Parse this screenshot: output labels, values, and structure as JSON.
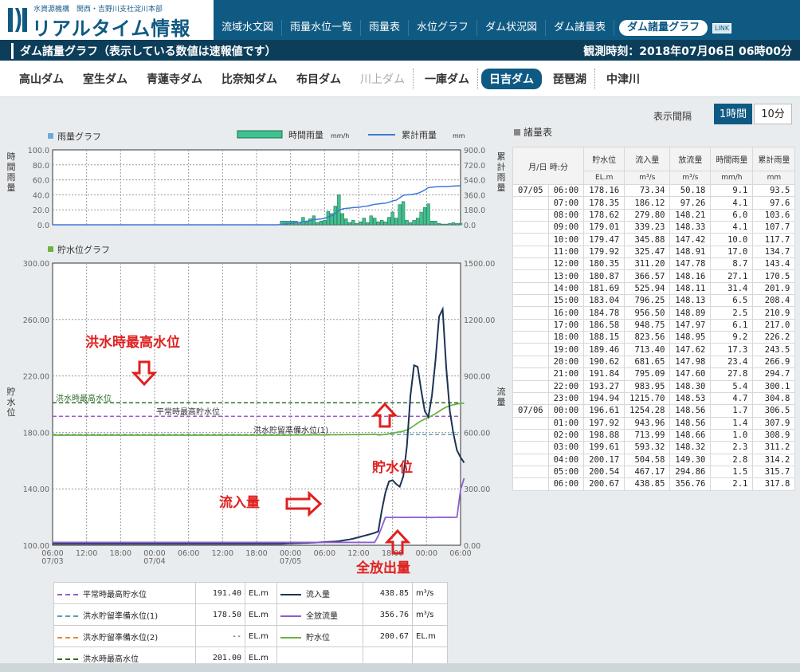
{
  "header": {
    "org": "水資源機構　関西・吉野川支社淀川本部",
    "title": "リアルタイム情報",
    "nav": [
      "流域水文図",
      "雨量水位一覧",
      "雨量表",
      "水位グラフ",
      "ダム状況図",
      "ダム諸量表",
      "ダム諸量グラフ"
    ],
    "badge": "LINK"
  },
  "titlebar": {
    "title": "ダム諸量グラフ（表示している数値は速報値です）",
    "observed": "観測時刻：2018年07月06日 06時00分"
  },
  "dams": [
    "高山ダム",
    "室生ダム",
    "青蓮寺ダム",
    "比奈知ダム",
    "布目ダム",
    "川上ダム",
    "一庫ダム",
    "日吉ダム",
    "琵琶湖",
    "中津川"
  ],
  "interval": {
    "label": "表示間隔",
    "options": [
      "1時間",
      "10分"
    ]
  },
  "table": {
    "title": "諸量表",
    "headers": [
      "月/日 時:分",
      "貯水位",
      "流入量",
      "放流量",
      "時間雨量",
      "累計雨量"
    ],
    "units": [
      "EL.m",
      "m³/s",
      "m³/s",
      "mm/h",
      "mm"
    ],
    "rows": [
      [
        "07/05",
        "06:00",
        "178.16",
        "73.34",
        "50.18",
        "9.1",
        "93.5"
      ],
      [
        "",
        "07:00",
        "178.35",
        "186.12",
        "97.26",
        "4.1",
        "97.6"
      ],
      [
        "",
        "08:00",
        "178.62",
        "279.80",
        "148.21",
        "6.0",
        "103.6"
      ],
      [
        "",
        "09:00",
        "179.01",
        "339.23",
        "148.33",
        "4.1",
        "107.7"
      ],
      [
        "",
        "10:00",
        "179.47",
        "345.88",
        "147.42",
        "10.0",
        "117.7"
      ],
      [
        "",
        "11:00",
        "179.92",
        "325.47",
        "148.91",
        "17.0",
        "134.7"
      ],
      [
        "",
        "12:00",
        "180.35",
        "311.20",
        "147.78",
        "8.7",
        "143.4"
      ],
      [
        "",
        "13:00",
        "180.87",
        "366.57",
        "148.16",
        "27.1",
        "170.5"
      ],
      [
        "",
        "14:00",
        "181.69",
        "525.94",
        "148.11",
        "31.4",
        "201.9"
      ],
      [
        "",
        "15:00",
        "183.04",
        "796.25",
        "148.13",
        "6.5",
        "208.4"
      ],
      [
        "",
        "16:00",
        "184.78",
        "956.50",
        "148.89",
        "2.5",
        "210.9"
      ],
      [
        "",
        "17:00",
        "186.58",
        "948.75",
        "147.97",
        "6.1",
        "217.0"
      ],
      [
        "",
        "18:00",
        "188.15",
        "823.56",
        "148.95",
        "9.2",
        "226.2"
      ],
      [
        "",
        "19:00",
        "189.46",
        "713.40",
        "147.62",
        "17.3",
        "243.5"
      ],
      [
        "",
        "20:00",
        "190.62",
        "681.65",
        "147.98",
        "23.4",
        "266.9"
      ],
      [
        "",
        "21:00",
        "191.84",
        "795.09",
        "147.60",
        "27.8",
        "294.7"
      ],
      [
        "",
        "22:00",
        "193.27",
        "983.95",
        "148.30",
        "5.4",
        "300.1"
      ],
      [
        "",
        "23:00",
        "194.94",
        "1215.70",
        "148.53",
        "4.7",
        "304.8"
      ],
      [
        "07/06",
        "00:00",
        "196.61",
        "1254.28",
        "148.56",
        "1.7",
        "306.5"
      ],
      [
        "",
        "01:00",
        "197.92",
        "943.96",
        "148.56",
        "1.4",
        "307.9"
      ],
      [
        "",
        "02:00",
        "198.88",
        "713.99",
        "148.66",
        "1.0",
        "308.9"
      ],
      [
        "",
        "03:00",
        "199.61",
        "593.32",
        "148.32",
        "2.3",
        "311.2"
      ],
      [
        "",
        "04:00",
        "200.17",
        "504.58",
        "149.30",
        "2.8",
        "314.2"
      ],
      [
        "",
        "05:00",
        "200.54",
        "467.17",
        "294.86",
        "1.5",
        "315.7"
      ],
      [
        "",
        "06:00",
        "200.67",
        "438.85",
        "356.76",
        "2.1",
        "317.8"
      ]
    ]
  },
  "legend": {
    "rows": [
      {
        "name": "平常時最高貯水位",
        "value": "191.40",
        "unit": "EL.m",
        "color": "#9a5fc9",
        "dash": true
      },
      {
        "name": "洪水貯留準備水位(1)",
        "value": "178.50",
        "unit": "EL.m",
        "color": "#5b9bb8",
        "dash": true
      },
      {
        "name": "洪水貯留準備水位(2)",
        "value": "--",
        "unit": "EL.m",
        "color": "#e48a3a",
        "dash": true
      },
      {
        "name": "洪水時最高水位",
        "value": "201.00",
        "unit": "EL.m",
        "color": "#2f6e2f",
        "dash": true
      }
    ],
    "series": [
      {
        "name": "流入量",
        "value": "438.85",
        "unit": "m³/s",
        "color": "#1b3355"
      },
      {
        "name": "全放流量",
        "value": "356.76",
        "unit": "m³/s",
        "color": "#8a5fd0"
      },
      {
        "name": "貯水位",
        "value": "200.67",
        "unit": "EL.m",
        "color": "#6cb33f"
      }
    ]
  },
  "chart_data": [
    {
      "type": "bar",
      "title": "雨量グラフ",
      "ylabel": "時間雨量",
      "y2label": "累計雨量",
      "ylim": [
        0,
        100
      ],
      "y2lim": [
        0,
        900
      ],
      "legend": [
        {
          "name": "時間雨量",
          "unit": "mm/h"
        },
        {
          "name": "累計雨量",
          "unit": "mm"
        }
      ],
      "yticks": [
        "100.0",
        "80.0",
        "60.0",
        "40.0",
        "20.0",
        "0.0"
      ],
      "y2ticks": [
        "900.0",
        "720.0",
        "540.0",
        "360.0",
        "180.0",
        "0.0"
      ],
      "x_start": "07/03 06:00",
      "x_step_hours": 1,
      "series": [
        {
          "name": "時間雨量",
          "values": [
            0,
            0,
            0,
            0,
            0,
            0,
            0,
            0,
            0,
            0,
            0,
            0,
            0,
            0,
            0,
            0,
            0,
            0,
            0,
            0,
            0,
            0,
            0,
            0,
            0,
            0,
            0,
            0,
            0,
            0,
            0,
            0,
            0,
            0,
            0,
            0,
            0,
            0,
            0,
            0,
            0,
            0,
            0,
            0,
            0,
            0,
            0,
            0,
            0,
            0,
            0,
            0,
            0,
            0,
            0,
            0,
            0,
            0,
            0,
            0,
            0,
            0,
            0,
            0,
            5,
            5,
            5,
            5,
            5,
            3,
            10,
            5,
            8,
            12,
            3,
            5,
            6,
            18,
            15,
            25,
            40,
            15,
            8,
            3,
            6,
            2,
            4,
            9,
            3,
            12,
            9,
            4,
            6,
            4,
            10,
            17,
            9,
            27,
            31,
            6,
            3,
            6,
            9,
            17,
            23,
            28,
            5,
            5,
            2,
            1,
            1,
            2,
            3,
            2,
            2
          ]
        },
        {
          "name": "累計雨量",
          "values": [
            0,
            0,
            0,
            0,
            0,
            0,
            0,
            0,
            0,
            0,
            0,
            0,
            0,
            0,
            0,
            0,
            0,
            0,
            0,
            0,
            0,
            0,
            0,
            0,
            0,
            0,
            0,
            0,
            0,
            0,
            0,
            0,
            0,
            0,
            0,
            0,
            0,
            0,
            0,
            0,
            0,
            0,
            0,
            0,
            0,
            0,
            0,
            0,
            0,
            0,
            0,
            0,
            0,
            0,
            0,
            0,
            0,
            0,
            0,
            0,
            0,
            0,
            0,
            0,
            5,
            10,
            15,
            20,
            25,
            28,
            38,
            43,
            51,
            63,
            66,
            71,
            77,
            95,
            110,
            135,
            175,
            190,
            198,
            201,
            207,
            209,
            213,
            222,
            225,
            237,
            246,
            250,
            256,
            260,
            270,
            287,
            296,
            323,
            354,
            360,
            363,
            369,
            378,
            395,
            418,
            446,
            451,
            456,
            458,
            459,
            460,
            462,
            465,
            467,
            469
          ]
        }
      ]
    },
    {
      "type": "line",
      "title": "貯水位グラフ",
      "ylabel": "貯水位",
      "y2label": "流量",
      "ylim": [
        100,
        300
      ],
      "y2lim": [
        0,
        1500
      ],
      "yticks": [
        "300.00",
        "260.00",
        "220.00",
        "180.00",
        "140.00",
        "100.00"
      ],
      "y2ticks": [
        "1500.00",
        "1200.00",
        "900.00",
        "600.00",
        "300.00",
        "0.00"
      ],
      "xticks": [
        "06:00",
        "12:00",
        "18:00",
        "00:00",
        "06:00",
        "12:00",
        "18:00",
        "00:00",
        "06:00",
        "12:00",
        "18:00",
        "00:00",
        "06:00"
      ],
      "xdates": [
        "07/03",
        "",
        "",
        "07/04",
        "",
        "",
        "",
        "07/05",
        "",
        "",
        "",
        "",
        ""
      ],
      "x_start": "07/03 06:00",
      "x_step_hours": 1,
      "lines": [
        {
          "name": "洪水時最高水位",
          "value": 201.0
        },
        {
          "name": "平常時最高貯水位",
          "value": 191.4
        },
        {
          "name": "洪水貯留準備水位(1)",
          "value": 178.5
        }
      ],
      "series": [
        {
          "name": "貯水位",
          "values": [
            178.0,
            178.0,
            178.0,
            178.0,
            178.0,
            178.0,
            178.0,
            178.0,
            178.0,
            178.0,
            178.0,
            178.0,
            178.0,
            178.0,
            178.0,
            178.0,
            178.0,
            178.0,
            178.0,
            178.0,
            178.0,
            178.0,
            178.0,
            178.0,
            178.0,
            178.0,
            178.0,
            178.0,
            178.0,
            178.0,
            178.0,
            178.0,
            178.0,
            178.0,
            178.0,
            178.0,
            178.0,
            178.0,
            178.0,
            178.0,
            178.0,
            178.0,
            178.0,
            178.0,
            178.0,
            178.0,
            178.0,
            178.0,
            178.0,
            178.0,
            178.0,
            178.0,
            178.0,
            178.0,
            178.0,
            178.0,
            178.0,
            178.0,
            178.0,
            178.0,
            178.0,
            178.0,
            178.0,
            178.0,
            178.0,
            178.0,
            178.0,
            178.1,
            178.1,
            178.1,
            178.1,
            178.1,
            178.1,
            178.2,
            178.2,
            178.2,
            178.2,
            178.2,
            178.3,
            178.3,
            178.3,
            178.3,
            178.4,
            178.4,
            178.4,
            178.4,
            178.5,
            178.5,
            178.6,
            178.6,
            178.8,
            178.16,
            178.35,
            178.62,
            179.01,
            179.47,
            179.92,
            180.35,
            180.87,
            181.69,
            183.04,
            184.78,
            186.58,
            188.15,
            189.46,
            190.62,
            191.84,
            193.27,
            194.94,
            196.61,
            197.92,
            198.88,
            199.61,
            200.17,
            200.54,
            200.67
          ]
        },
        {
          "name": "流入量",
          "values": [
            8,
            8,
            8,
            8,
            8,
            8,
            8,
            8,
            8,
            8,
            8,
            8,
            8,
            8,
            8,
            8,
            8,
            8,
            8,
            8,
            8,
            8,
            8,
            8,
            8,
            8,
            8,
            8,
            8,
            8,
            8,
            8,
            8,
            8,
            8,
            8,
            8,
            8,
            8,
            8,
            8,
            8,
            8,
            8,
            8,
            8,
            8,
            8,
            8,
            8,
            8,
            8,
            8,
            8,
            8,
            8,
            8,
            8,
            8,
            8,
            8,
            8,
            8,
            8,
            8,
            9,
            10,
            10,
            11,
            11,
            12,
            12,
            13,
            14,
            15,
            16,
            17,
            18,
            19,
            20,
            22,
            25,
            28,
            31,
            35,
            40,
            45,
            50,
            55,
            60,
            66,
            73.34,
            186.12,
            279.8,
            339.23,
            345.88,
            325.47,
            311.2,
            366.57,
            525.94,
            796.25,
            956.5,
            948.75,
            823.56,
            713.4,
            681.65,
            795.09,
            983.95,
            1215.7,
            1254.28,
            943.96,
            713.99,
            593.32,
            504.58,
            467.17,
            438.85
          ]
        },
        {
          "name": "全放流量",
          "values": [
            15,
            15,
            15,
            15,
            15,
            15,
            15,
            15,
            15,
            15,
            15,
            15,
            15,
            15,
            15,
            15,
            15,
            15,
            15,
            15,
            15,
            15,
            15,
            15,
            15,
            15,
            15,
            15,
            15,
            15,
            15,
            15,
            15,
            15,
            15,
            15,
            15,
            15,
            15,
            15,
            15,
            15,
            15,
            15,
            15,
            15,
            15,
            15,
            15,
            15,
            15,
            15,
            15,
            15,
            15,
            15,
            15,
            15,
            15,
            15,
            15,
            15,
            15,
            15,
            15,
            15,
            15,
            15,
            15,
            15,
            15,
            15,
            15,
            15,
            15,
            15,
            15,
            15,
            15,
            15,
            15,
            15,
            15,
            15,
            15,
            15,
            15,
            15,
            15,
            15,
            15,
            50.18,
            97.26,
            148.21,
            148.33,
            147.42,
            148.91,
            147.78,
            148.16,
            148.11,
            148.13,
            148.89,
            147.97,
            148.95,
            147.62,
            147.98,
            147.6,
            148.3,
            148.53,
            148.56,
            148.56,
            148.66,
            148.32,
            149.3,
            294.86,
            356.76
          ]
        }
      ],
      "annotations": [
        "洪水時最高水位",
        "流入量",
        "貯水位",
        "全放出量"
      ]
    }
  ]
}
